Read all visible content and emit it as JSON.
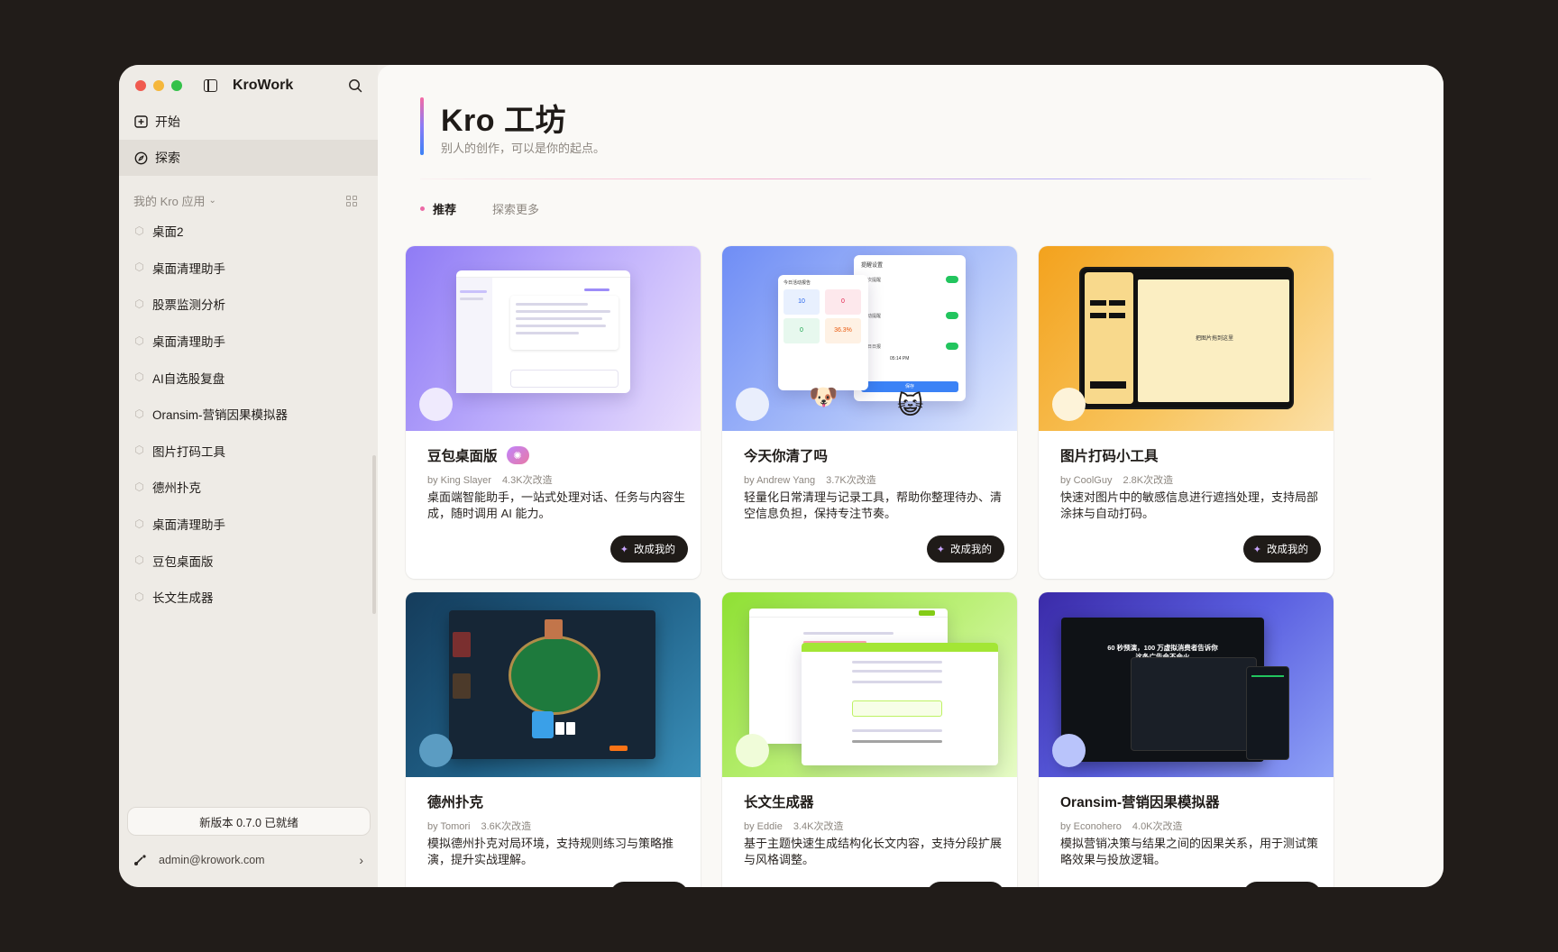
{
  "app": {
    "title": "KroWork"
  },
  "nav": {
    "start": "开始",
    "explore": "探索"
  },
  "my_apps": {
    "heading": "我的 Kro 应用",
    "items": [
      "桌面2",
      "桌面清理助手",
      "股票监测分析",
      "桌面清理助手",
      "AI自选股复盘",
      "Oransim-营销因果模拟器",
      "图片打码工具",
      "德州扑克",
      "桌面清理助手",
      "豆包桌面版",
      "长文生成器"
    ]
  },
  "footer": {
    "update": "新版本 0.7.0 已就绪",
    "user": "admin@krowork.com"
  },
  "page": {
    "title": "Kro 工坊",
    "subtitle": "别人的创作，可以是你的起点。"
  },
  "tabs": {
    "recommended": "推荐",
    "more": "探索更多"
  },
  "remix_label": "改成我的",
  "cards": [
    {
      "title": "豆包桌面版",
      "author": "by King Slayer",
      "stats": "4.3K次改造",
      "desc": "桌面端智能助手，一站式处理对话、任务与内容生成，随时调用 AI 能力。",
      "bg": "linear-gradient(120deg,#8f7bf5 0%,#b9a9fb 45%,#eadffd 100%)",
      "dot": "#efeafd"
    },
    {
      "title": "今天你清了吗",
      "author": "by Andrew Yang",
      "stats": "3.7K次改造",
      "desc": "轻量化日常清理与记录工具，帮助你整理待办、清空信息负担，保持专注节奏。",
      "bg": "linear-gradient(130deg,#6f8df5 0%,#a8bdf9 55%,#dfe7fd 100%)",
      "dot": "#e9eefc"
    },
    {
      "title": "图片打码小工具",
      "author": "by CoolGuy",
      "stats": "2.8K次改造",
      "desc": "快速对图片中的敏感信息进行遮挡处理，支持局部涂抹与自动打码。",
      "bg": "linear-gradient(130deg,#f3a21d 0%,#f8c45d 55%,#fbe0a8 100%)",
      "dot": "#fdf3d9"
    },
    {
      "title": "德州扑克",
      "author": "by Tomori",
      "stats": "3.6K次改造",
      "desc": "模拟德州扑克对局环境，支持规则练习与策略推演，提升实战理解。",
      "bg": "linear-gradient(135deg,#153c5b 0%,#1f5f86 50%,#3a8fb8 100%)",
      "dot": "#5b9cc2"
    },
    {
      "title": "长文生成器",
      "author": "by Eddie",
      "stats": "3.4K次改造",
      "desc": "基于主题快速生成结构化长文内容，支持分段扩展与风格调整。",
      "bg": "linear-gradient(135deg,#8fe034 0%,#bdf07a 55%,#e6fbc6 100%)",
      "dot": "#f0fcd9"
    },
    {
      "title": "Oransim-营销因果模拟器",
      "author": "by Econohero",
      "stats": "4.0K次改造",
      "desc": "模拟营销决策与结果之间的因果关系，用于测试策略效果与投放逻辑。",
      "bg": "linear-gradient(135deg,#3a2aa8 0%,#5a5fe0 50%,#8fa2f7 100%)",
      "dot": "#b9c4fb"
    }
  ],
  "thumb_text": {
    "reminder_title": "提醒设置",
    "today_report": "今日活动报告",
    "stat_a": "10",
    "stat_b": "0",
    "stat_c": "0",
    "stat_d": "36.3%",
    "r1": "每次提醒",
    "r2": "运动提醒",
    "r3": "每日日报",
    "time": "05:14 PM",
    "confirm": "保存",
    "mosaic_hint": "把图片拖到这里",
    "poker_hero": "60 秒预演，100 万虚拟消费者告诉你",
    "poker_hero2": "这条广告会不会火"
  },
  "colors": {
    "accent": "#ec6aa6",
    "dark": "#1f1b18"
  }
}
